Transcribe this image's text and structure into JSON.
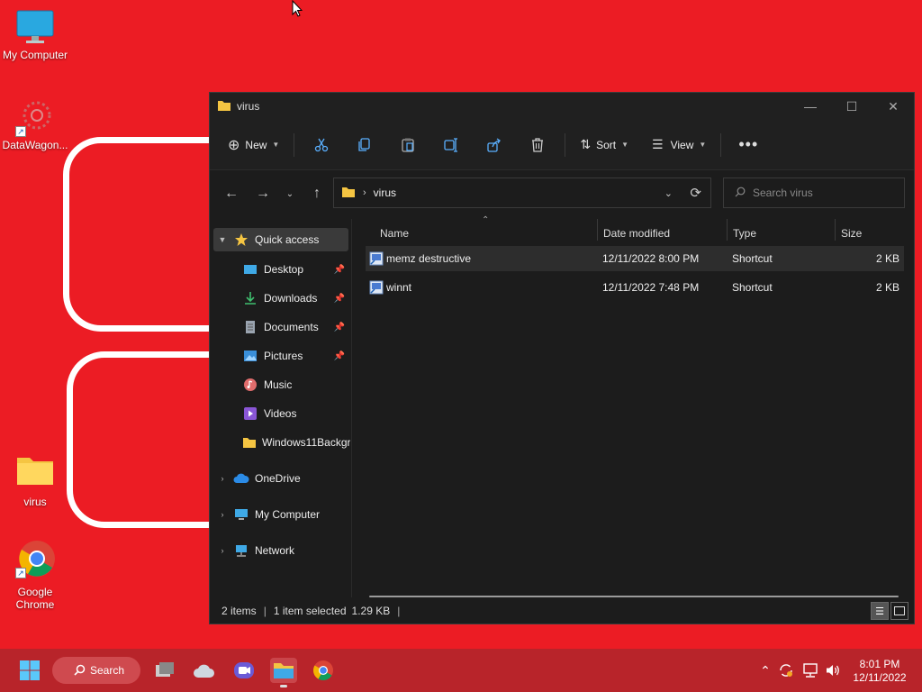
{
  "desktop": {
    "icons": [
      {
        "label": "My Computer"
      },
      {
        "label": "DataWagon..."
      },
      {
        "label": "virus"
      },
      {
        "label": "Google Chrome"
      }
    ]
  },
  "window": {
    "title": "virus",
    "toolbar": {
      "new_label": "New",
      "sort_label": "Sort",
      "view_label": "View"
    },
    "address": {
      "path": "virus",
      "search_placeholder": "Search virus"
    },
    "nav": {
      "quick_access": "Quick access",
      "items": [
        {
          "label": "Desktop"
        },
        {
          "label": "Downloads"
        },
        {
          "label": "Documents"
        },
        {
          "label": "Pictures"
        },
        {
          "label": "Music"
        },
        {
          "label": "Videos"
        },
        {
          "label": "Windows11Backgr"
        }
      ],
      "onedrive": "OneDrive",
      "my_computer": "My Computer",
      "network": "Network"
    },
    "columns": {
      "name": "Name",
      "date": "Date modified",
      "type": "Type",
      "size": "Size"
    },
    "files": [
      {
        "name": "memz destructive",
        "date": "12/11/2022 8:00 PM",
        "type": "Shortcut",
        "size": "2 KB"
      },
      {
        "name": "winnt",
        "date": "12/11/2022 7:48 PM",
        "type": "Shortcut",
        "size": "2 KB"
      }
    ],
    "status": {
      "count": "2 items",
      "selection": "1 item selected",
      "size": "1.29 KB"
    }
  },
  "taskbar": {
    "search_label": "Search",
    "time": "8:01 PM",
    "date": "12/11/2022"
  },
  "colors": {
    "desktop_bg": "#ec1c24",
    "taskbar_bg": "#b8242a",
    "window_bg": "#1c1c1c",
    "folder": "#f5c542"
  }
}
